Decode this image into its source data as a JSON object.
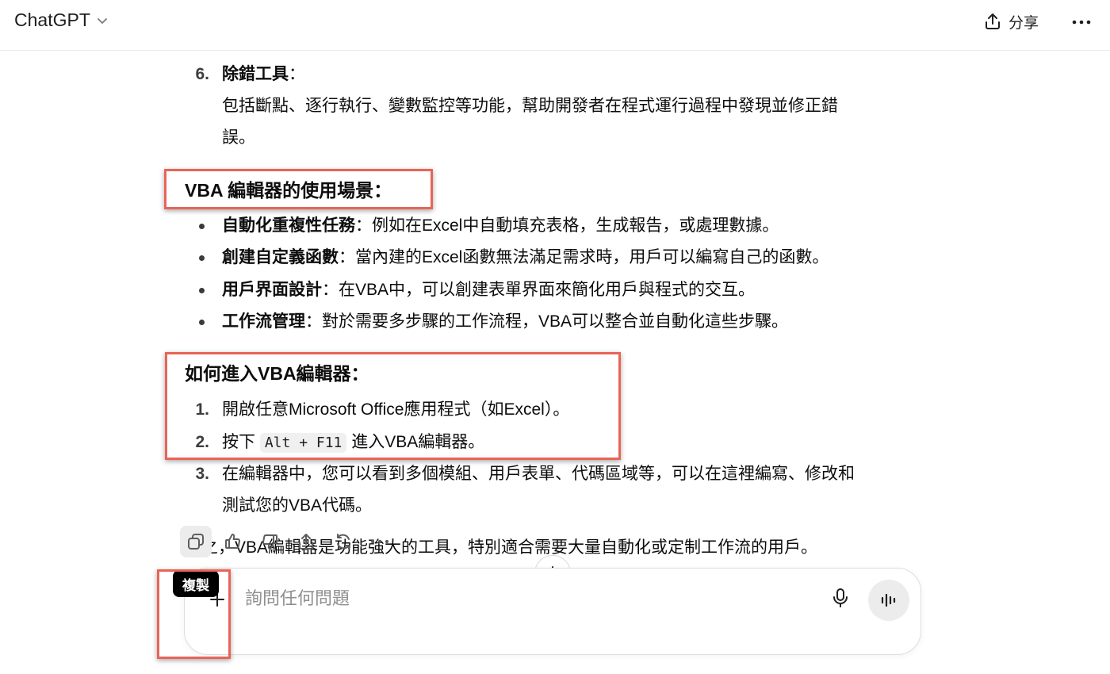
{
  "header": {
    "title": "ChatGPT",
    "share_label": "分享"
  },
  "content": {
    "debug_item": {
      "number": "6.",
      "title": "除錯工具",
      "colon": "：",
      "desc_line1": "包括斷點、逐行執行、變數監控等功能，幫助開發者在程式運行過程中發現並修正錯",
      "desc_line2": "誤。"
    },
    "use_cases": {
      "heading": "VBA 編輯器的使用場景：",
      "items": [
        {
          "title": "自動化重複性任務",
          "text": "：例如在Excel中自動填充表格，生成報告，或處理數據。"
        },
        {
          "title": "創建自定義函數",
          "text": "：當內建的Excel函數無法滿足需求時，用戶可以編寫自己的函數。"
        },
        {
          "title": "用戶界面設計",
          "text": "：在VBA中，可以創建表單界面來簡化用戶與程式的交互。"
        },
        {
          "title": "工作流管理",
          "text": "：對於需要多步驟的工作流程，VBA可以整合並自動化這些步驟。"
        }
      ]
    },
    "how_to": {
      "heading": "如何進入VBA編輯器：",
      "step1": {
        "number": "1.",
        "text": "開啟任意Microsoft Office應用程式（如Excel）。"
      },
      "step2": {
        "number": "2.",
        "pre": "按下",
        "kbd": "Alt + F11",
        "post": "進入VBA編輯器。"
      },
      "step3": {
        "number": "3.",
        "line1": "在編輯器中，您可以看到多個模組、用戶表單、代碼區域等，可以在這裡編寫、修改和",
        "line2": "測試您的VBA代碼。"
      }
    },
    "summary": "總之，VBA編輯器是功能強大的工具，特別適合需要大量自動化或定制工作流的用戶。"
  },
  "actions": {
    "tooltip": "複製",
    "icons": [
      "copy-icon",
      "thumbs-up-icon",
      "thumbs-down-icon",
      "share-icon",
      "regenerate-icon",
      "more-icon"
    ]
  },
  "composer": {
    "placeholder": "詢問任何問題"
  },
  "colors": {
    "highlight_box": "#e96457",
    "text": "#0d0d0d"
  }
}
